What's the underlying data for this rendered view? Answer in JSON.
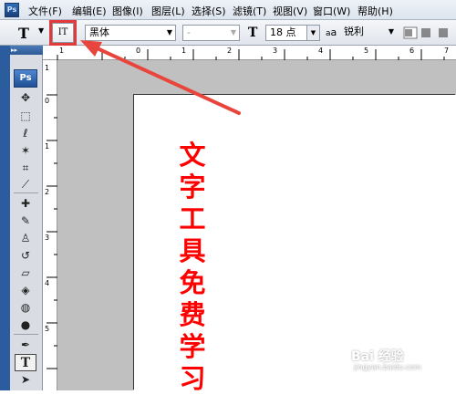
{
  "menubar": {
    "logo": "Ps",
    "items": [
      "文件(F)",
      "编辑(E)",
      "图像(I)",
      "图层(L)",
      "选择(S)",
      "滤镜(T)",
      "视图(V)",
      "窗口(W)",
      "帮助(H)"
    ]
  },
  "options": {
    "tool_glyph": "T",
    "orient_glyph": "IT",
    "font_family": "黑体",
    "font_style": "-",
    "font_size": "18 点",
    "aa_label": "a",
    "antialias": "锐利"
  },
  "toolbox": {
    "badge": "Ps"
  },
  "rulers": {
    "top_labels": [
      "1",
      "0",
      "1",
      "2",
      "3",
      "4",
      "5",
      "6",
      "7"
    ],
    "left_labels": [
      "1",
      "0",
      "1",
      "2",
      "3",
      "4",
      "5"
    ]
  },
  "canvas": {
    "text": "文字工具免费学习",
    "text_color": "#ff0000"
  },
  "watermark": {
    "main": "Bai 经验",
    "sub": "jingyan.baidu.com"
  }
}
